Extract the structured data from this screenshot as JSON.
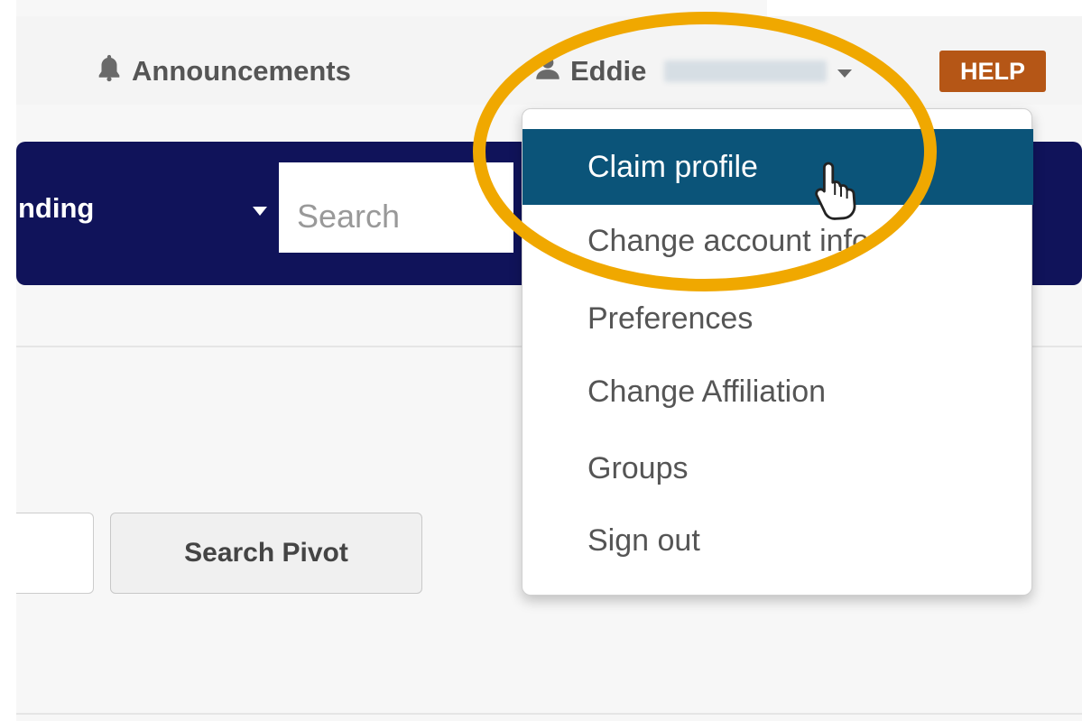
{
  "topnav": {
    "announcements_label": "Announcements",
    "user_first_name": "Eddie",
    "help_label": "HELP"
  },
  "navbar": {
    "dropdown_label": "nding",
    "search_placeholder": "Search"
  },
  "dropdown_menu": {
    "items": [
      {
        "label": "Claim profile",
        "active": true
      },
      {
        "label": "Change account info",
        "active": false
      },
      {
        "label": "Preferences",
        "active": false
      },
      {
        "label": "Change Affiliation",
        "active": false
      },
      {
        "label": "Groups",
        "active": false
      },
      {
        "label": "Sign out",
        "active": false
      }
    ]
  },
  "search_area": {
    "button_label": "Search Pivot"
  },
  "icons": {
    "announcements": "bell-icon",
    "account": "user-icon",
    "cursor": "hand-pointer-icon"
  },
  "colors": {
    "navbar_bg": "#10135a",
    "active_menu_bg": "#0b5479",
    "help_badge_bg": "#b55616",
    "highlight_ring": "#f0a800"
  }
}
